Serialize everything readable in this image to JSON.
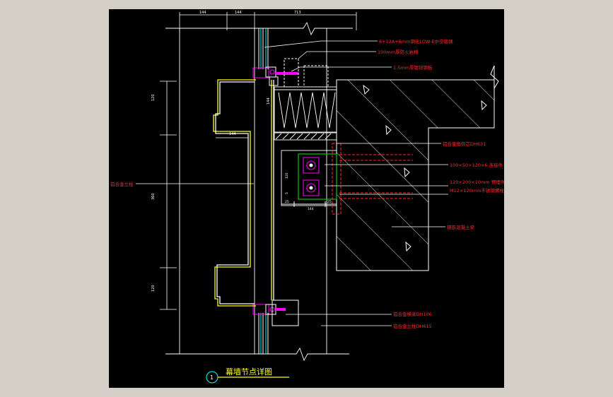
{
  "colors": {
    "frame_bg": "#d4d0c8",
    "canvas_bg": "#000000",
    "line_white": "#ffffff",
    "annotation_red": "#ff2a2a",
    "profile_yellow": "#ffff00",
    "bracket_green": "#00c800",
    "bolt_magenta": "#ff00ff",
    "title_cyan": "#00ffff"
  },
  "title": {
    "main": "幕墙节点详图",
    "symbol": "1"
  },
  "top_dims": [
    "144",
    "144",
    "713"
  ],
  "left_dims": [
    "120",
    "144",
    "360",
    "120"
  ],
  "inner_dims": {
    "upper": "144",
    "bracket_bottom": [
      "25",
      "144",
      "25"
    ],
    "bracket_side": [
      "120",
      "5"
    ]
  },
  "callouts_right": [
    "6+12A+6mm钢化LOW-E中空玻璃",
    "100mm厚防火岩棉",
    "1.5mm厚镀锌钢板",
    "铝合金角码芯DH631",
    "100×50×120×6 连接件",
    "120×200×10mm 预埋件",
    "M12×120mm不锈钢螺栓",
    "钢筋混凝土梁"
  ],
  "callouts_bottom": [
    "铝合金横梁DH106",
    "铝合金立柱DH615"
  ],
  "callout_left": "铝合金立柱"
}
